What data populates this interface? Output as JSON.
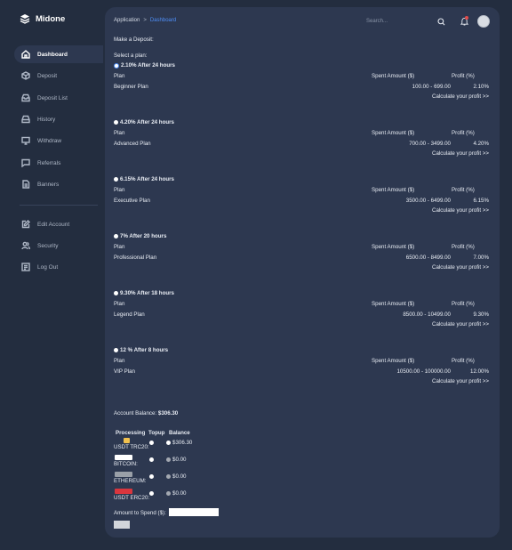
{
  "brand": {
    "name": "Midone"
  },
  "sidebar": {
    "items": [
      {
        "label": "Dashboard",
        "icon": "home-icon",
        "active": true
      },
      {
        "label": "Deposit",
        "icon": "box-icon"
      },
      {
        "label": "Deposit List",
        "icon": "inbox-icon"
      },
      {
        "label": "History",
        "icon": "hard-drive-icon"
      },
      {
        "label": "Withdraw",
        "icon": "monitor-icon"
      },
      {
        "label": "Referrals",
        "icon": "chat-icon"
      },
      {
        "label": "Banners",
        "icon": "file-icon"
      },
      {
        "label": "Edit Account",
        "icon": "edit-icon"
      },
      {
        "label": "Security",
        "icon": "users-icon"
      },
      {
        "label": "Log Out",
        "icon": "logout-icon"
      }
    ]
  },
  "header": {
    "breadcrumb": [
      "Application",
      "Dashboard"
    ],
    "breadcrumb_separator": ">",
    "search_placeholder": "Search...",
    "accent_color": "#4e8ef7",
    "notification_dot_color": "#e24c4b"
  },
  "deposit": {
    "title": "Make a Deposit:",
    "select_plan": "Select a plan:",
    "col_plan": "Plan",
    "col_spent": "Spent Amount ($)",
    "col_profit": "Profit (%)",
    "calc_label": "Calculate your profit >>",
    "plans": [
      {
        "heading": "2.10% After 24 hours",
        "name": "Beginner Plan",
        "range": "100.00 - 699.00",
        "profit": "2.10%",
        "selected": true
      },
      {
        "heading": "4.20% After 24 hours",
        "name": "Advanced Plan",
        "range": "700.00 - 3499.00",
        "profit": "4.20%"
      },
      {
        "heading": "6.15% After 24 hours",
        "name": "Executive Plan",
        "range": "3500.00 - 6499.00",
        "profit": "6.15%"
      },
      {
        "heading": "7% After 20 hours",
        "name": "Professional Plan",
        "range": "6500.00 - 8499.00",
        "profit": "7.00%"
      },
      {
        "heading": "9.30% After 18 hours",
        "name": "Legend Plan",
        "range": "8500.00 - 10499.00",
        "profit": "9.30%"
      },
      {
        "heading": "12 % After 8 hours",
        "name": "VIP Plan",
        "range": "10500.00 - 100000.00",
        "profit": "12.00%"
      }
    ],
    "account_balance_label": "Account Balance: ",
    "account_balance_value": "$306.30",
    "processing": {
      "headers": {
        "processing": "Processing",
        "topup": "Topup",
        "balance": "Balance"
      },
      "rows": [
        {
          "name": "USDT TRC20:",
          "balance": "$306.30",
          "logo_color": "#f2c14e"
        },
        {
          "name": "BITCOIN:",
          "balance": "$0.00",
          "logo_color": "#ffffff"
        },
        {
          "name": "ETHEREUM:",
          "balance": "$0.00",
          "logo_color": "#9aa0a8"
        },
        {
          "name": "USDT ERC20:",
          "balance": "$0.00",
          "logo_color": "#d9363e"
        }
      ]
    },
    "amount_label": "Amount to Spend ($):"
  }
}
